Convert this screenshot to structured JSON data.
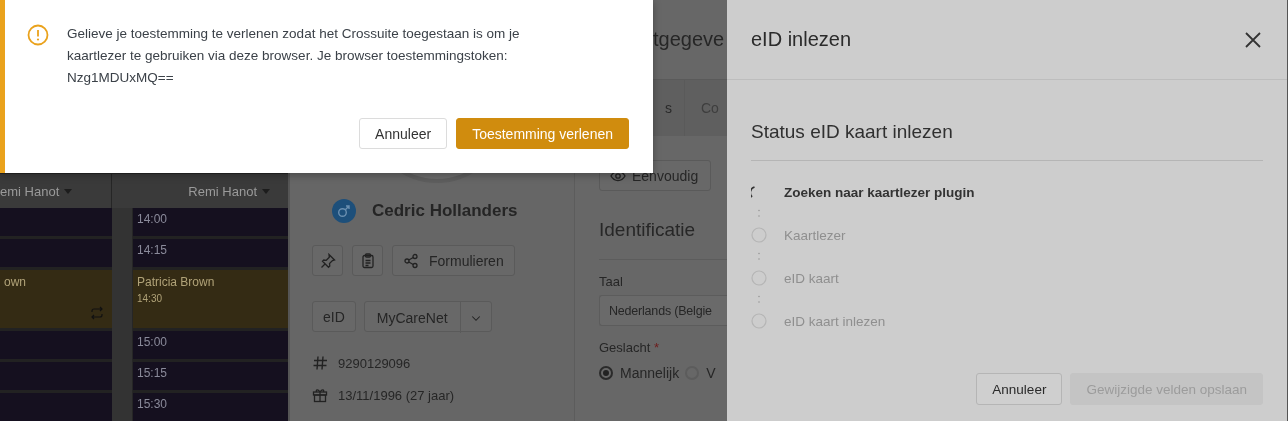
{
  "calendar": {
    "columns": [
      {
        "header": "emi Hanot",
        "slots": [
          {
            "kind": "slot"
          },
          {
            "kind": "slot"
          },
          {
            "kind": "appointment",
            "title": "own",
            "recurring": true
          },
          {
            "kind": "slot"
          },
          {
            "kind": "slot"
          },
          {
            "kind": "slot"
          }
        ]
      },
      {
        "header": "Remi Hanot",
        "slots": [
          {
            "kind": "slot",
            "time": "14:00"
          },
          {
            "kind": "slot",
            "time": "14:15"
          },
          {
            "kind": "appointment",
            "title": "Patricia Brown",
            "time": "14:30",
            "recurring": false
          },
          {
            "kind": "slot",
            "time": "15:00"
          },
          {
            "kind": "slot",
            "time": "15:15"
          },
          {
            "kind": "slot",
            "time": "15:30"
          }
        ]
      }
    ]
  },
  "patient": {
    "name": "Cedric Hollanders",
    "actions": [
      {
        "kind": "pin"
      },
      {
        "kind": "clipboard"
      },
      {
        "kind": "share",
        "label": "Formulieren"
      }
    ],
    "buttons": [
      {
        "label": "eID"
      },
      {
        "label": "MyCareNet",
        "dropdown": true
      }
    ],
    "id_number": "9290129096",
    "birth": "13/11/1996 (27 jaar)"
  },
  "form": {
    "title": "tgegeve",
    "tabs": [
      "s",
      "Co"
    ],
    "view_button": "Eenvoudig",
    "section": "Identificatie",
    "language": {
      "label": "Taal",
      "value": "Nederlands (Belgie"
    },
    "gender": {
      "label": "Geslacht",
      "required_mark": "*",
      "options": [
        {
          "label": "Mannelijk",
          "selected": true
        },
        {
          "label": "V",
          "selected": false
        }
      ]
    }
  },
  "drawer": {
    "title": "eID inlezen",
    "heading": "Status eID kaart inlezen",
    "steps": [
      {
        "label": "Zoeken naar kaartlezer plugin",
        "active": true
      },
      {
        "label": "Kaartlezer",
        "active": false
      },
      {
        "label": "eID kaart",
        "active": false
      },
      {
        "label": "eID kaart inlezen",
        "active": false
      }
    ],
    "buttons": [
      {
        "label": "Annuleer",
        "disabled": false
      },
      {
        "label": "Gewijzigde velden opslaan",
        "disabled": true
      }
    ]
  },
  "modal": {
    "message": "Gelieve je toestemming te verlenen zodat het Crossuite toegestaan is om je kaartlezer te gebruiken via deze browser. Je browser toestemmingstoken: Nzg1MDUxMQ==",
    "buttons": [
      {
        "label": "Annuleer",
        "kind": "secondary"
      },
      {
        "label": "Toestemming verlenen",
        "kind": "primary"
      }
    ]
  }
}
